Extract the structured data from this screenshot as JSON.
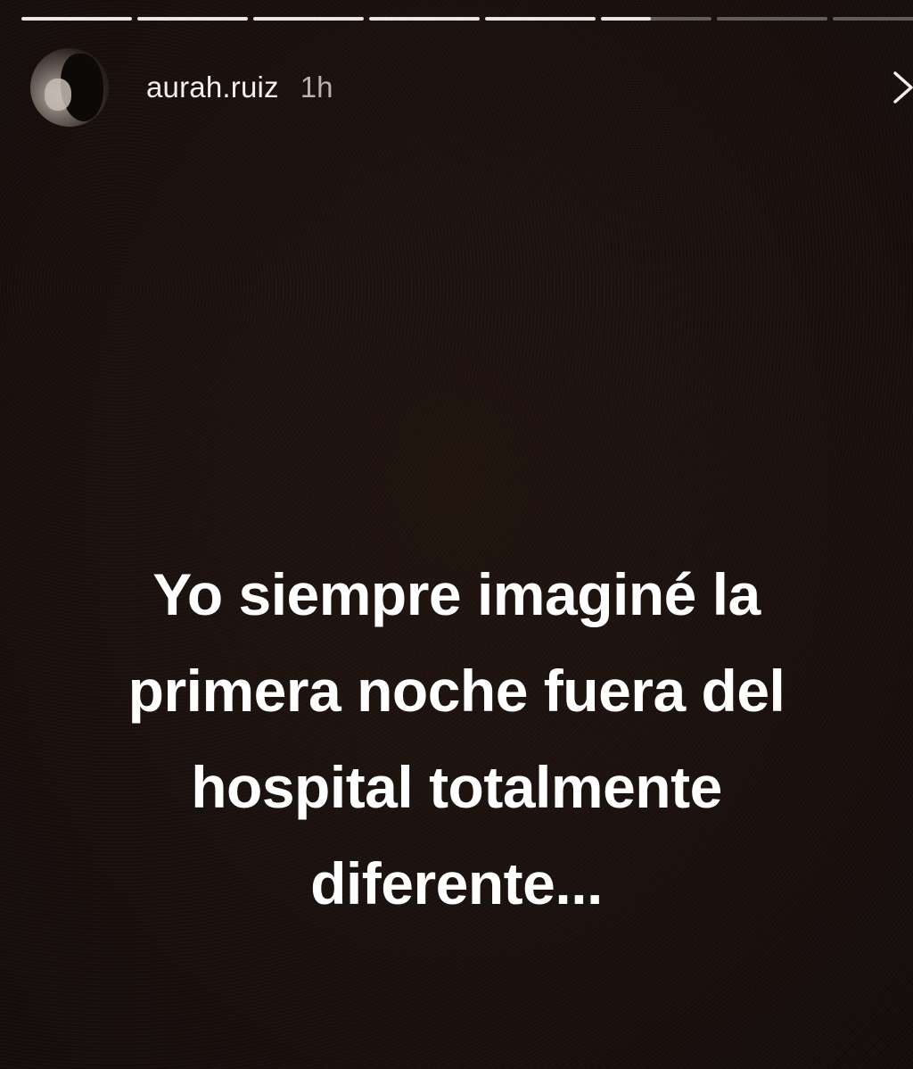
{
  "story": {
    "progress": [
      1,
      1,
      1,
      1,
      1,
      0.45,
      0,
      0
    ],
    "user": {
      "username": "aurah.ruiz",
      "time_ago": "1h",
      "avatar_icon": "profile-photo"
    },
    "next_icon": "chevron-right-icon",
    "caption_lines": [
      "Yo siempre imaginé la",
      "primera noche fuera del",
      "hospital totalmente",
      "diferente..."
    ],
    "colors": {
      "background": "#1c1210",
      "text": "#ffffff",
      "progress_filled": "#e9e7e6",
      "progress_empty": "#5a5351"
    }
  }
}
